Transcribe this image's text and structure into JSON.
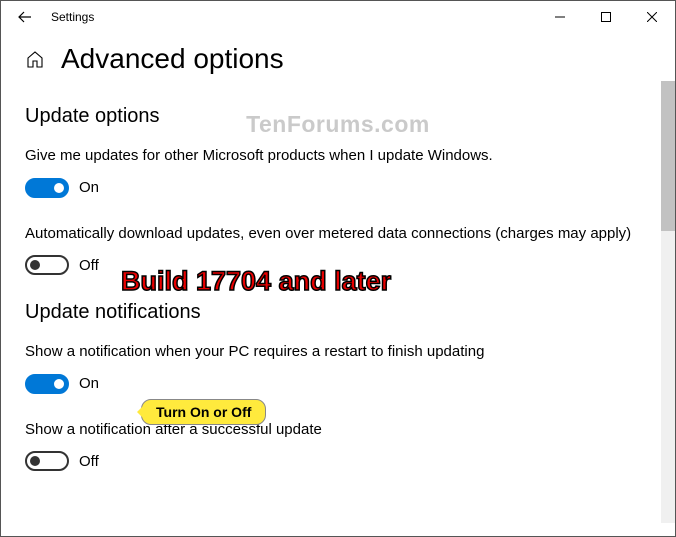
{
  "window": {
    "title": "Settings"
  },
  "page": {
    "title": "Advanced options"
  },
  "sections": {
    "update_options": {
      "title": "Update options",
      "opt1": {
        "text": "Give me updates for other Microsoft products when I update Windows.",
        "state_label": "On",
        "on": true
      },
      "opt2": {
        "text": "Automatically download updates, even over metered data connections (charges may apply)",
        "state_label": "Off",
        "on": false
      }
    },
    "update_notifications": {
      "title": "Update notifications",
      "opt1": {
        "text": "Show a notification when your PC requires a restart to finish updating",
        "state_label": "On",
        "on": true
      },
      "opt2": {
        "text": "Show a notification after a successful update",
        "state_label": "Off",
        "on": false
      }
    }
  },
  "annotations": {
    "watermark": "TenForums.com",
    "build": "Build 17704 and later",
    "callout": "Turn On or Off"
  }
}
